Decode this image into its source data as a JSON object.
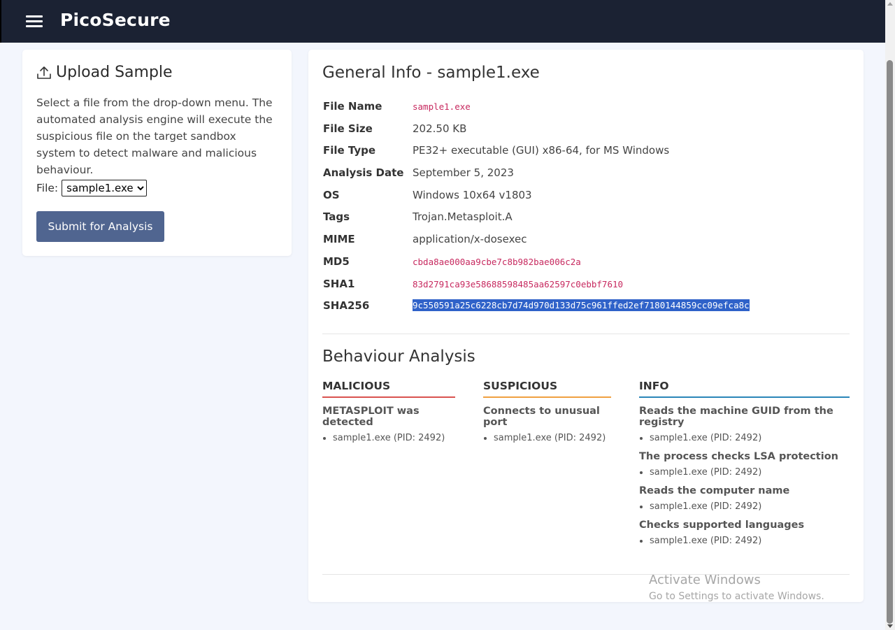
{
  "header": {
    "brand": "PicoSecure"
  },
  "upload": {
    "title": "Upload Sample",
    "description": "Select a file from the drop-down menu. The automated analysis engine will execute the suspicious file on the target sandbox system to detect malware and malicious behaviour.",
    "file_label": "File:",
    "file_selected": "sample1.exe",
    "submit_label": "Submit for Analysis"
  },
  "general": {
    "title": "General Info - sample1.exe",
    "rows": [
      {
        "key": "File Name",
        "value": "sample1.exe"
      },
      {
        "key": "File Size",
        "value": "202.50 KB"
      },
      {
        "key": "File Type",
        "value": "PE32+ executable (GUI) x86-64, for MS Windows"
      },
      {
        "key": "Analysis Date",
        "value": "September 5, 2023"
      },
      {
        "key": "OS",
        "value": "Windows 10x64 v1803"
      },
      {
        "key": "Tags",
        "value": "Trojan.Metasploit.A"
      },
      {
        "key": "MIME",
        "value": "application/x-dosexec"
      },
      {
        "key": "MD5",
        "value": "cbda8ae000aa9cbe7c8b982bae006c2a"
      },
      {
        "key": "SHA1",
        "value": "83d2791ca93e58688598485aa62597c0ebbf7610"
      },
      {
        "key": "SHA256",
        "value": "9c550591a25c6228cb7d74d970d133d75c961ffed2ef7180144859cc09efca8c"
      }
    ]
  },
  "behaviour": {
    "title": "Behaviour Analysis",
    "columns": [
      {
        "heading": "MALICIOUS",
        "color": "#d9534f",
        "items": [
          {
            "title": "METASPLOIT was detected",
            "detail": "sample1.exe (PID: 2492)"
          }
        ]
      },
      {
        "heading": "SUSPICIOUS",
        "color": "#f0a040",
        "items": [
          {
            "title": "Connects to unusual port",
            "detail": "sample1.exe (PID: 2492)"
          }
        ]
      },
      {
        "heading": "INFO",
        "color": "#2a86b8",
        "items": [
          {
            "title": "Reads the machine GUID from the registry",
            "detail": "sample1.exe (PID: 2492)"
          },
          {
            "title": "The process checks LSA protection",
            "detail": "sample1.exe (PID: 2492)"
          },
          {
            "title": "Reads the computer name",
            "detail": "sample1.exe (PID: 2492)"
          },
          {
            "title": "Checks supported languages",
            "detail": "sample1.exe (PID: 2492)"
          }
        ]
      }
    ]
  },
  "watermark": {
    "line1": "Activate Windows",
    "line2": "Go to Settings to activate Windows."
  }
}
